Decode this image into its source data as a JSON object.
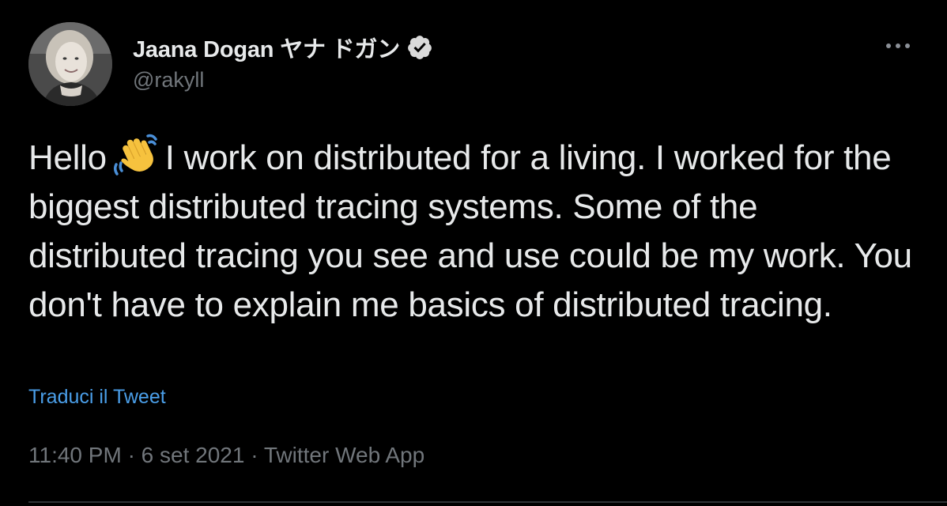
{
  "author": {
    "display_name": "Jaana Dogan ヤナ ドガン",
    "handle": "@rakyll",
    "verified": true,
    "avatar_icon": "avatar-photo"
  },
  "menu": {
    "icon": "more-horizontal-icon"
  },
  "tweet": {
    "text_before_emoji": "Hello",
    "emoji": "👋",
    "text_after_emoji": "I work on distributed for a living. I worked for the biggest distributed tracing systems. Some of the distributed tracing you see and use could be my work. You don't have to explain me basics of distributed tracing."
  },
  "translate_label": "Traduci il Tweet",
  "meta": {
    "time": "11:40 PM",
    "separator": "·",
    "date": "6 set 2021",
    "source": "Twitter Web App"
  },
  "colors": {
    "background": "#000000",
    "text": "#e7e9ea",
    "secondary": "#71767b",
    "link": "#4a9ee8",
    "verified_badge": "#d9d9d9"
  }
}
